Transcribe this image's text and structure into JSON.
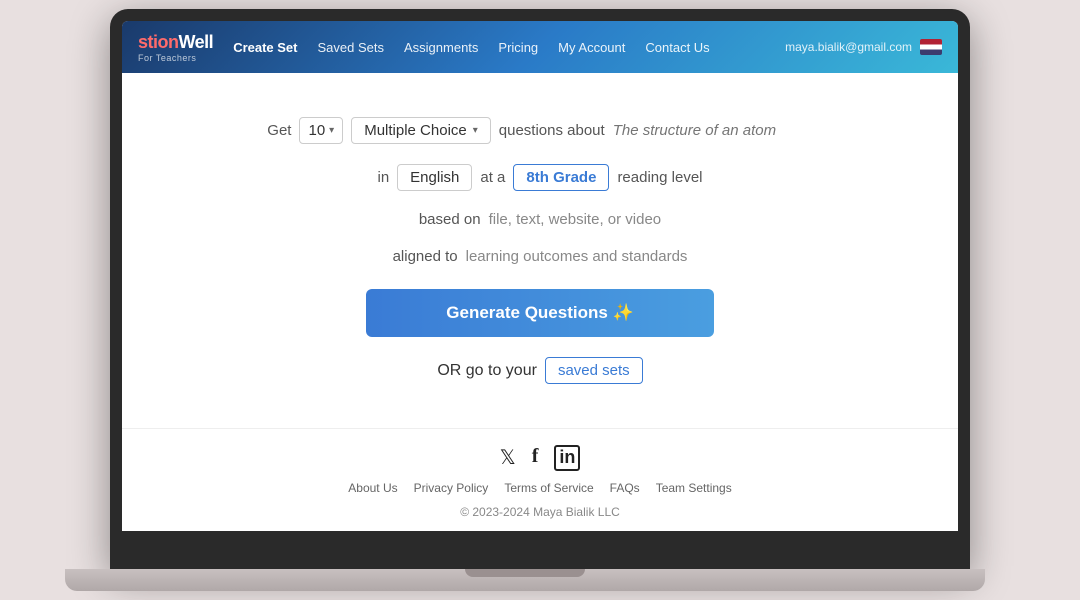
{
  "logo": {
    "prefix": "stion",
    "brand": "Well",
    "subtitle": "For Teachers"
  },
  "nav": {
    "create_set": "Create Set",
    "saved_sets": "Saved Sets",
    "assignments": "Assignments",
    "pricing": "Pricing",
    "my_account": "My Account",
    "contact_us": "Contact Us",
    "user_email": "maya.bialik@gmail.com"
  },
  "form": {
    "get_label": "Get",
    "count": "10",
    "question_type": "Multiple Choice",
    "questions_about_label": "questions about",
    "topic_placeholder": "The structure of an atom",
    "in_label": "in",
    "language": "English",
    "at_a_label": "at a",
    "grade": "8th Grade",
    "reading_level_label": "reading level",
    "based_on_label": "based on",
    "based_on_text": "file, text, website, or video",
    "aligned_to_label": "aligned to",
    "aligned_to_text": "learning outcomes and standards",
    "generate_btn": "Generate Questions ✨"
  },
  "saved": {
    "or_go_label": "OR go to your",
    "saved_sets_link": "saved sets"
  },
  "social": {
    "twitter": "𝕏",
    "facebook": "f",
    "linkedin": "in"
  },
  "footer": {
    "about_us": "About Us",
    "privacy_policy": "Privacy Policy",
    "terms_of_service": "Terms of Service",
    "faqs": "FAQs",
    "team_settings": "Team Settings",
    "copyright": "© 2023-2024 Maya Bialik LLC"
  }
}
